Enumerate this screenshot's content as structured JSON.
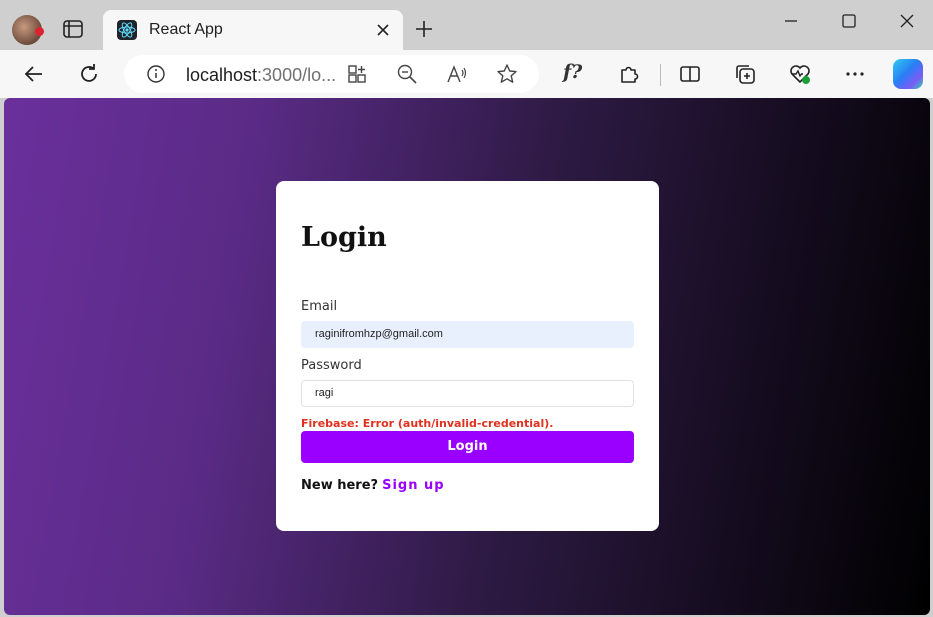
{
  "browser": {
    "tab_title": "React App",
    "url_host": "localhost",
    "url_rest": ":3000/lo...",
    "profile_icon": "avatar",
    "icons": {
      "tab_actions": "tab-actions-icon",
      "favicon": "react-icon",
      "close": "close-icon",
      "new_tab": "plus-icon",
      "back": "back-arrow-icon",
      "refresh": "refresh-icon",
      "info": "info-icon",
      "apps": "apps-icon",
      "zoom": "zoom-out-icon",
      "read_aloud": "read-aloud-icon",
      "favorite": "star-icon",
      "formula": "f?",
      "extensions": "puzzle-icon",
      "split": "split-screen-icon",
      "collections": "collections-icon",
      "health": "browser-essentials-icon",
      "more": "more-icon",
      "copilot": "copilot-icon"
    }
  },
  "page": {
    "background_colors": [
      "#6a2f9c",
      "#000000"
    ],
    "title": "Login",
    "email_label": "Email",
    "email_value": "raginifromhzp@gmail.com",
    "password_label": "Password",
    "password_value": "ragi",
    "error_text": "Firebase: Error (auth/invalid-credential).",
    "login_button": "Login",
    "signup_prompt": "New here?",
    "signup_link": "Sign up",
    "accent_color": "#9900ff",
    "error_color": "#e0301e"
  }
}
